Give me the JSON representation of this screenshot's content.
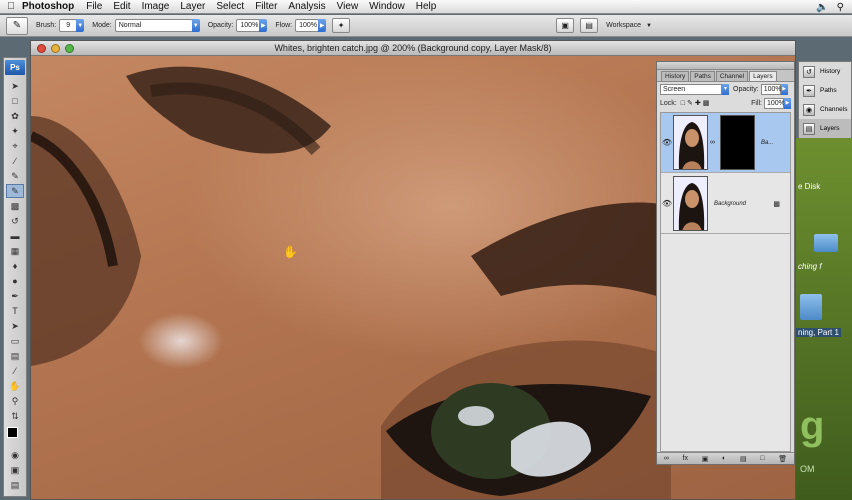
{
  "menubar": {
    "app": "Photoshop",
    "items": [
      "File",
      "Edit",
      "Image",
      "Layer",
      "Select",
      "Filter",
      "Analysis",
      "View",
      "Window",
      "Help"
    ]
  },
  "options": {
    "brush_label": "Brush:",
    "brush_size": "9",
    "mode_label": "Mode:",
    "mode_value": "Normal",
    "opacity_label": "Opacity:",
    "opacity_value": "100%",
    "flow_label": "Flow:",
    "flow_value": "100%",
    "workspace_label": "Workspace"
  },
  "document": {
    "title": "Whites, brighten catch.jpg @ 200% (Background copy, Layer Mask/8)"
  },
  "panel": {
    "tabs": [
      "History",
      "Paths",
      "Channel",
      "Layers"
    ],
    "blend_mode": "Screen",
    "opacity_label": "Opacity:",
    "opacity_value": "100%",
    "lock_label": "Lock:",
    "fill_label": "Fill:",
    "fill_value": "100%",
    "layers": [
      {
        "name": "Ba...",
        "selected": true,
        "has_mask": true
      },
      {
        "name": "Background",
        "selected": false,
        "has_mask": false
      }
    ]
  },
  "dock": {
    "items": [
      "History",
      "Paths",
      "Channels",
      "Layers"
    ]
  },
  "desktop": {
    "labels": [
      "e Disk",
      "ching f",
      "ning, Part 1",
      "g",
      "OM"
    ]
  },
  "colors": {
    "skin": "#b97b56",
    "desktop_green": "#5b7a28",
    "selection_blue": "#a8c8f0"
  }
}
